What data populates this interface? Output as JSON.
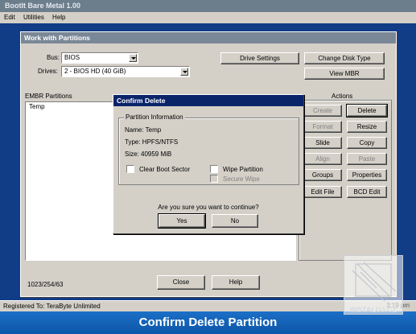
{
  "app": {
    "title": "BootIt Bare Metal 1.00"
  },
  "menu": {
    "edit": "Edit",
    "utilities": "Utilities",
    "help": "Help"
  },
  "window": {
    "title": "Work with Partitions",
    "bus_label": "Bus:",
    "bus_value": "BIOS",
    "drives_label": "Drives:",
    "drives_value": "2 - BIOS HD (40 GiB)",
    "drive_settings": "Drive Settings",
    "change_disk_type": "Change Disk Type",
    "view_mbr": "View MBR",
    "partitions_header": "EMBR Partitions",
    "partitions": [
      "Temp"
    ],
    "actions_header": "Actions",
    "actions": {
      "create": "Create",
      "delete": "Delete",
      "format": "Format",
      "resize": "Resize",
      "slide": "Slide",
      "copy": "Copy",
      "align": "Align",
      "paste": "Paste",
      "groups": "Groups",
      "properties": "Properties",
      "edit_file": "Edit File",
      "bcd_edit": "BCD Edit"
    },
    "geometry": "1023/254/63",
    "close": "Close",
    "help": "Help"
  },
  "dialog": {
    "title": "Confirm Delete",
    "group_title": "Partition Information",
    "name": "Name: Temp",
    "type": "Type: HPFS/NTFS",
    "size": "Size: 40959 MiB",
    "clear_boot_sector": "Clear Boot Sector",
    "wipe_partition": "Wipe Partition",
    "secure_wipe": "Secure Wipe",
    "question": "Are you sure you want to continue?",
    "yes": "Yes",
    "no": "No"
  },
  "status": {
    "registered": "Registered To: TeraByte Unlimited",
    "time": "3:19 pm"
  },
  "caption": "Confirm Delete Partition",
  "watermark": "INSTALUJ.CZ",
  "colors": {
    "desktop": "#113c86",
    "dialog_title": "#0a246a",
    "caption_bar": "#1c6fc7"
  }
}
